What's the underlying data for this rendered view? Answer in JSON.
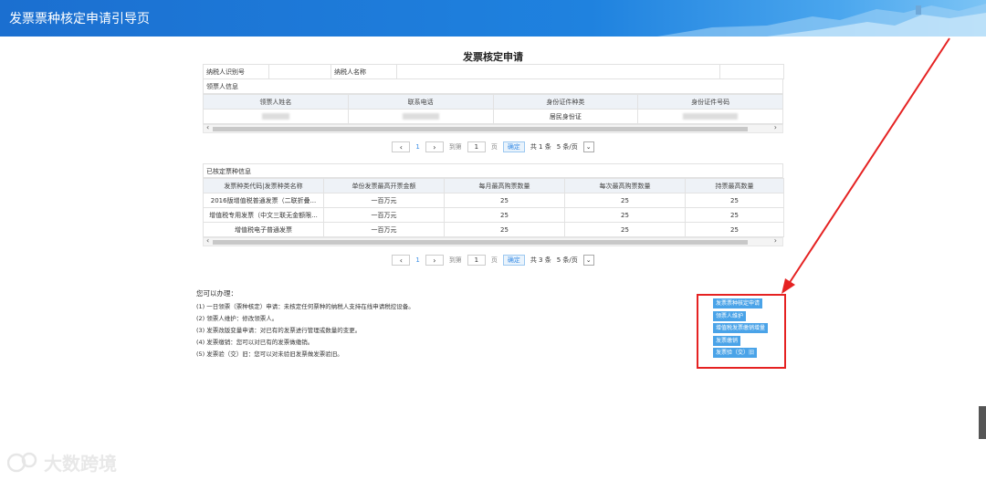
{
  "header": {
    "title": "发票票种核定申请引导页"
  },
  "page_title": "发票核定申请",
  "taxpayer": {
    "id_label": "纳税人识别号",
    "name_label": "纳税人名称"
  },
  "recipient": {
    "section_label": "领票人信息",
    "headers": [
      "领票人姓名",
      "联系电话",
      "身份证件种类",
      "身份证件号码"
    ],
    "row": [
      "",
      "",
      "居民身份证",
      ""
    ]
  },
  "pager1": {
    "page": "1",
    "goto": "到第",
    "input": "1",
    "unit": "页",
    "confirm": "确定",
    "total": "共 1 条",
    "size": "5 条/页"
  },
  "approved": {
    "section_label": "已核定票种信息",
    "headers": [
      "发票种类代码|发票种类名称",
      "单份发票最高开票金额",
      "每月最高购票数量",
      "每次最高购票数量",
      "持票最高数量"
    ],
    "rows": [
      [
        "2016版增值税普通发票（二联折叠...",
        "一百万元",
        "25",
        "25",
        "25"
      ],
      [
        "增值税专用发票（中文三联无金额限...",
        "一百万元",
        "25",
        "25",
        "25"
      ],
      [
        "增值税电子普通发票",
        "一百万元",
        "25",
        "25",
        "25"
      ]
    ]
  },
  "pager2": {
    "page": "1",
    "goto": "到第",
    "input": "1",
    "unit": "页",
    "confirm": "确定",
    "total": "共 3 条",
    "size": "5 条/页"
  },
  "info": {
    "lead": "您可以办理：",
    "items": [
      "(1) 一日领票（票种核定）申请：未核定任何票种的纳税人支持在线申请税控设备。",
      "(2) 领票人维护：修改领票人。",
      "(3) 发票改版变量申请：对已有的发票进行管理或数量的变更。",
      "(4) 发票缴销：您可以对已有的发票做缴销。",
      "(5) 发票验（交）旧：您可以对未验旧发票做发票验旧。"
    ]
  },
  "actions": [
    "发票票种核定申请",
    "领票人维护",
    "增值税发票缴销增量",
    "发票缴销",
    "发票验（交）旧"
  ],
  "watermark": {
    "text": "大数跨境"
  },
  "colors": {
    "header": "#1f7fdc",
    "accent": "#4aa3e8",
    "highlight": "#e52222"
  }
}
